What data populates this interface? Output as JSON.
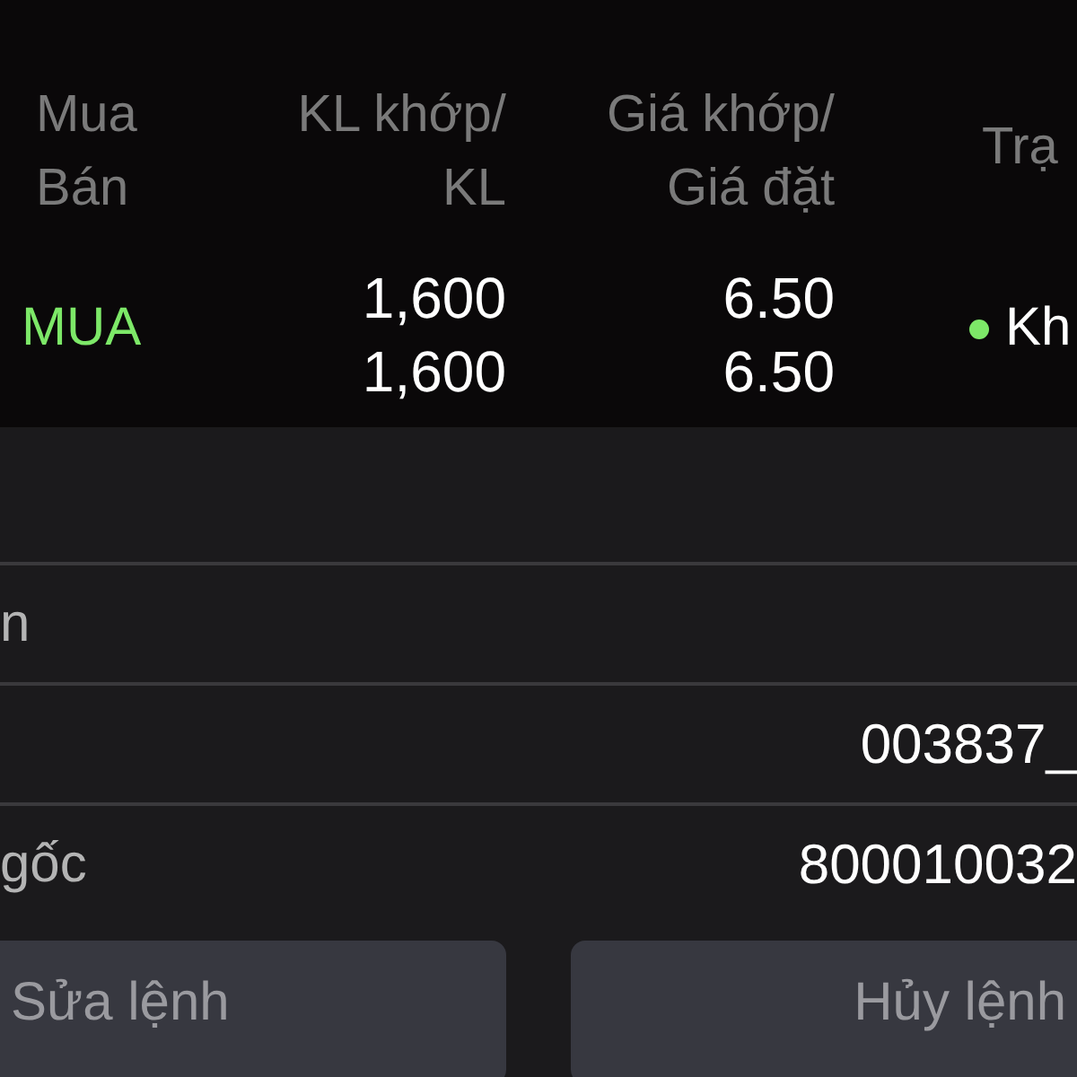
{
  "table": {
    "columns": [
      {
        "lines": [
          "Mua",
          "Bán"
        ]
      },
      {
        "lines": [
          "KL khớp/",
          "KL"
        ]
      },
      {
        "lines": [
          "Giá khớp/",
          "Giá đặt"
        ]
      },
      {
        "lines": [
          "Trạ"
        ]
      }
    ],
    "rows": [
      {
        "side": "MUA",
        "kind": "buy",
        "matched_qty": "1,600",
        "qty": "1,600",
        "matched_price": "6.50",
        "price": "6.50",
        "status": "Kh",
        "color": "#7de868"
      }
    ]
  },
  "details": [
    {
      "label": "n"
    },
    {
      "value": "003837_"
    },
    {
      "label": "gốc",
      "value": "800010032"
    }
  ],
  "buttons": [
    "Sửa lệnh",
    "Hủy lệnh"
  ]
}
